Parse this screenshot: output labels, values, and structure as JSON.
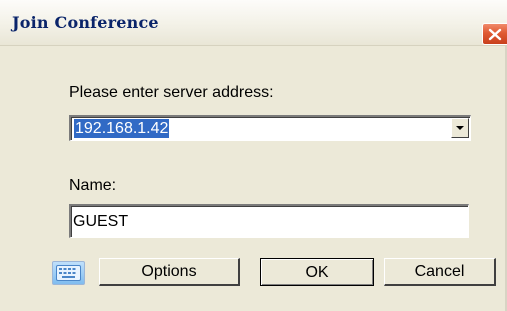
{
  "window": {
    "title": "Join Conference"
  },
  "server": {
    "label": "Please enter server address:",
    "selected_value": "192.168.1.42"
  },
  "name_field": {
    "label": "Name:",
    "value": "GUEST"
  },
  "buttons": {
    "options": "Options",
    "ok": "OK",
    "cancel": "Cancel"
  },
  "icons": {
    "keyboard": "keyboard-icon",
    "close": "close-icon",
    "dropdown": "chevron-down-icon"
  },
  "colors": {
    "title_text": "#0a246a",
    "selection": "#316ac5",
    "close_button": "#e05a33",
    "dialog_background": "#ece9d8"
  }
}
